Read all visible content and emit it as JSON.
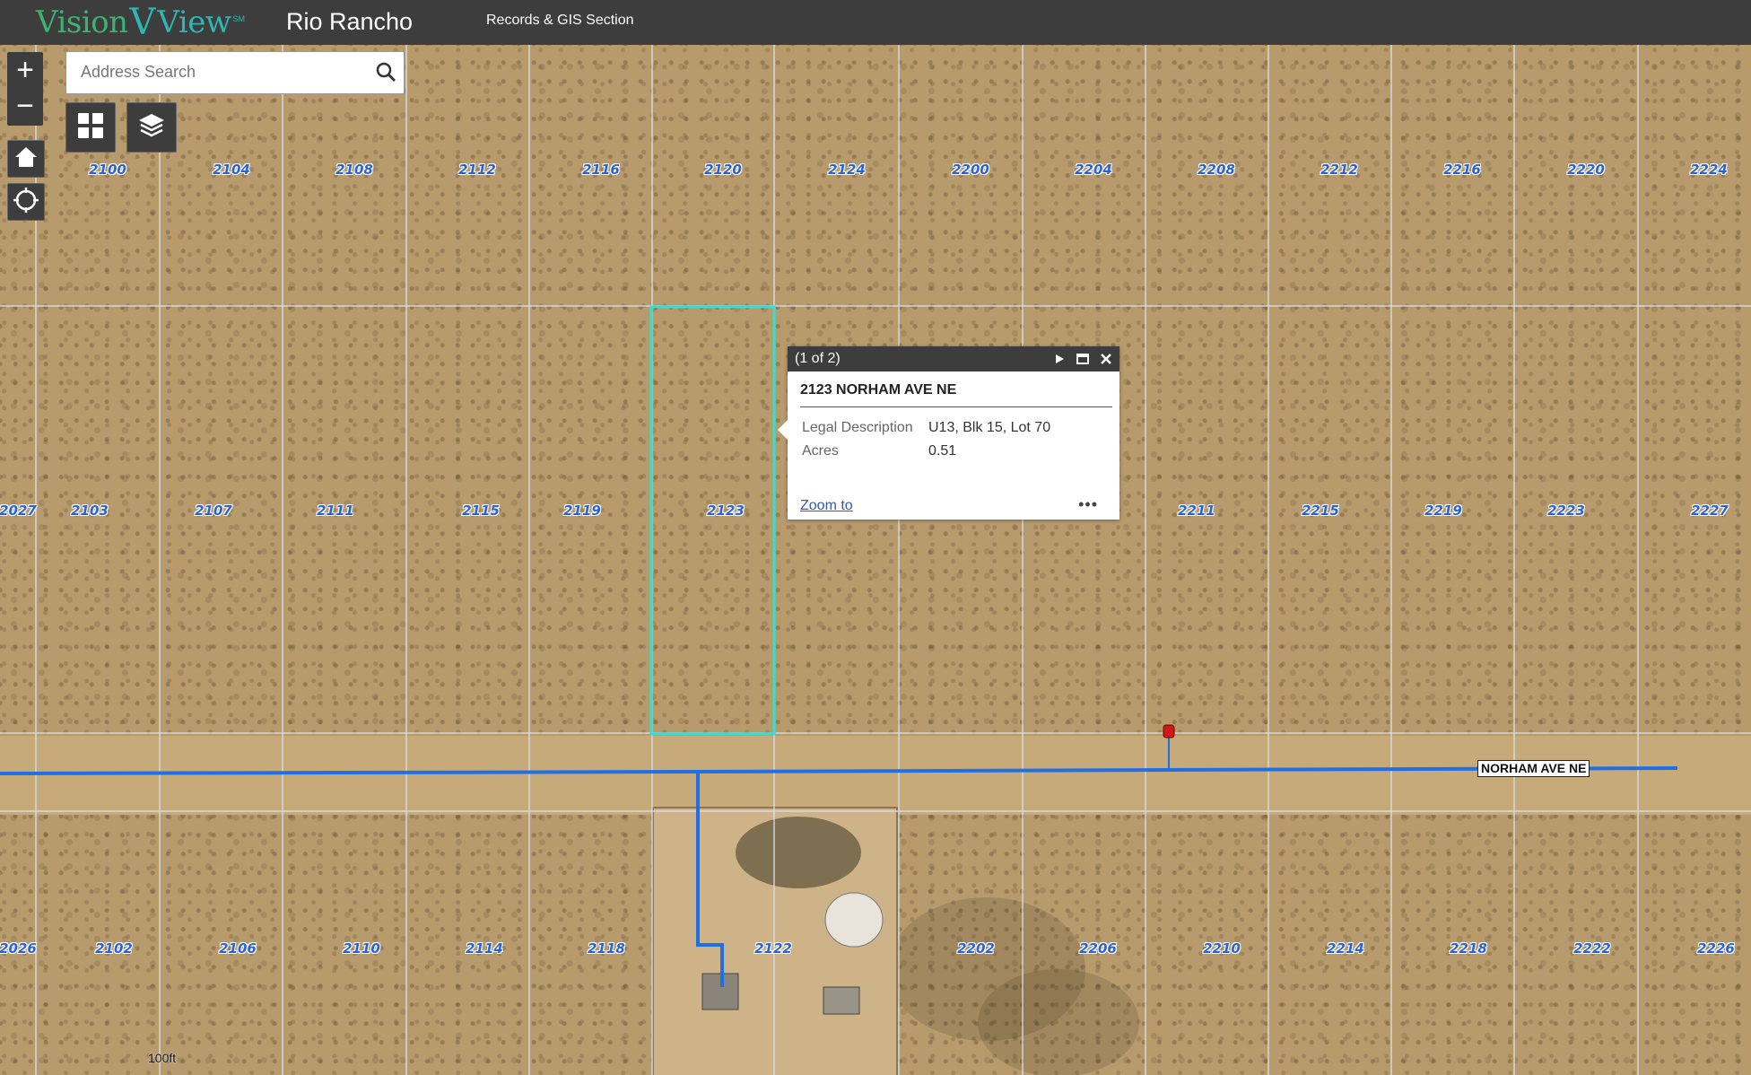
{
  "header": {
    "logo": {
      "vision": "Vision",
      "v": "V",
      "view": "View",
      "sm": "SM"
    },
    "city": "Rio Rancho",
    "section": "Records & GIS Section"
  },
  "controls": {
    "zoom_in": "+",
    "zoom_out": "−",
    "search_placeholder": "Address Search",
    "icons": [
      "basemap-gallery-icon",
      "layers-icon",
      "home-icon",
      "locate-icon",
      "search-icon"
    ]
  },
  "map": {
    "lot_numbers_top": [
      "2100",
      "2104",
      "2108",
      "2112",
      "2116",
      "2120",
      "2124",
      "2200",
      "2204",
      "2208",
      "2212",
      "2216",
      "2220",
      "2224"
    ],
    "lot_numbers_middle": [
      "2027",
      "2103",
      "2107",
      "2111",
      "2115",
      "2119",
      "2123",
      "2211",
      "2215",
      "2219",
      "2223",
      "2227"
    ],
    "lot_numbers_bottom": [
      "2026",
      "2102",
      "2106",
      "2110",
      "2114",
      "2118",
      "2122",
      "2202",
      "2206",
      "2210",
      "2214",
      "2218",
      "2222",
      "2226"
    ],
    "road_label": "NORHAM AVE NE",
    "selection_color": "#2ee0d8",
    "line_color": "#1f6fe6",
    "scale_label": "100ft"
  },
  "popup": {
    "counter": "(1 of 2)",
    "title": "2123 NORHAM AVE NE",
    "rows": [
      {
        "key": "Legal Description",
        "value": "U13, Blk 15, Lot 70"
      },
      {
        "key": "Acres",
        "value": "0.51"
      }
    ],
    "zoom_to": "Zoom to",
    "more": "•••"
  }
}
